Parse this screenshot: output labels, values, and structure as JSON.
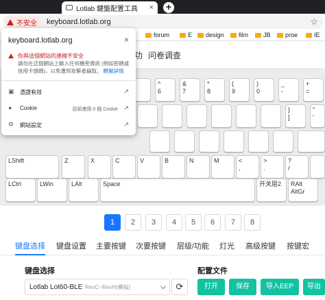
{
  "browser": {
    "tab_title": "Lotlab 鍵盤配置工具",
    "tab_close": "×",
    "new_tab": "+",
    "security_chip": "不安全",
    "url": "keyboard.lotlab.org",
    "star": "☆",
    "bookmarks": [
      "forum",
      "E",
      "design",
      "film",
      "JB",
      "proe",
      "IE"
    ]
  },
  "popup": {
    "site": "keyboard.lotlab.org",
    "close": "×",
    "warning_title": "你與這個網站的連線不安全",
    "warning_body": "請勿在這個網站上輸入任何機密資訊 (例如密碼或信用卡號碼)，以免遭到攻擊者竊取。",
    "learn_more": "瞭解詳情",
    "cert_label": "憑證有效",
    "cookie_label": "Cookie",
    "cookie_value": "目前使用 0 個 Cookie",
    "site_settings_label": "網站設定"
  },
  "page": {
    "top_nav_partial": "功",
    "top_nav_survey": "问卷调查",
    "pager": [
      "1",
      "2",
      "3",
      "4",
      "5",
      "6",
      "7",
      "8"
    ],
    "pager_active": "1",
    "subtabs": [
      "键盘选择",
      "键盘设置",
      "主要按键",
      "次要按键",
      "层级/功能",
      "灯光",
      "高级按键",
      "按键宏"
    ],
    "subtab_active": "键盘选择",
    "keyboard_select_title": "键盘选择",
    "keyboard_selected": "Lotlab Lot60-BLE",
    "keyboard_selected_sub": "RevC~RevH(模拟)",
    "refresh_icon": "⟳",
    "config_title": "配置文件",
    "config_buttons": [
      "打开",
      "保存",
      "导入EEP",
      "导出"
    ]
  },
  "keys": {
    "k_r1_1a": "{",
    "k_r1_1b": "[",
    "k_r1_2a": "^",
    "k_r1_2b": "6",
    "k_r1_3a": "&",
    "k_r1_3b": "7",
    "k_r1_4a": "*",
    "k_r1_4b": "8",
    "k_r1_5a": "(",
    "k_r1_5b": "9",
    "k_r1_6a": ")",
    "k_r1_6b": "0",
    "k_r1_7a": "_",
    "k_r1_7b": "-",
    "k_r1_8a": "+",
    "k_r1_8b": "=",
    "k_r1_9a": "|",
    "k_r1_9b": "\\",
    "k_r2_bracket_a": "}",
    "k_r2_bracket_b": "]",
    "k_r2_last_a": "\"",
    "k_r2_last_b": "'",
    "k_r3_lshift": "LShift",
    "k_r3_z": "Z",
    "k_r3_x": "X",
    "k_r3_c": "C",
    "k_r3_v": "V",
    "k_r3_b": "B",
    "k_r3_n": "N",
    "k_r3_m": "M",
    "k_r3_comma_a": "<",
    "k_r3_comma_b": ",",
    "k_r3_period_a": ">",
    "k_r3_period_b": ".",
    "k_r3_slash_a": "?",
    "k_r3_slash_b": "/",
    "k_r4_lctrl": "LCtrl",
    "k_r4_lwin": "LWin",
    "k_r4_lalt": "LAlt",
    "k_r4_space": "Space",
    "k_r4_fn": "开关层2",
    "k_r4_ralt_a": "RAlt",
    "k_r4_ralt_b": "AltGr",
    "k_corner_mark": "^"
  }
}
